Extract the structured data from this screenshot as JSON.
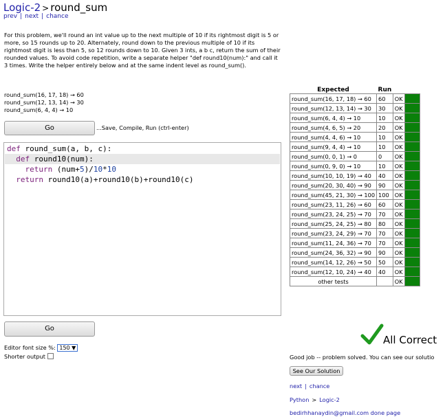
{
  "header": {
    "crumb": "Logic-2",
    "separator": ">",
    "title": "round_sum"
  },
  "nav": {
    "prev": "prev",
    "next": "next",
    "chance": "chance",
    "bar": "|"
  },
  "description": "For this problem, we'll round an int value up to the next multiple of 10 if its rightmost digit is 5 or more, so 15 rounds up to 20. Alternately, round down to the previous multiple of 10 if its rightmost digit is less than 5, so 12 rounds down to 10. Given 3 ints, a b c, return the sum of their rounded values. To avoid code repetition, write a separate helper \"def round10(num):\" and call it 3 times. Write the helper entirely below and at the same indent level as round_sum().",
  "examples": [
    "round_sum(16, 17, 18) → 60",
    "round_sum(12, 13, 14) → 30",
    "round_sum(6, 4, 4) → 10"
  ],
  "go_label": "Go",
  "save_hint": "...Save, Compile, Run (ctrl-enter)",
  "code": {
    "l1_kw": "def",
    "l1": " round_sum(a, b, c):",
    "l2_kw": "def",
    "l2": " round10(num):",
    "l3_kw": "return",
    "l3a": " (num+",
    "l3n1": "5",
    "l3b": ")/",
    "l3n2": "10",
    "l3c": "*",
    "l3n3": "10",
    "l4_kw": "return",
    "l4": " round10(a)+round10(b)+round10(c)"
  },
  "editor_font_label": "Editor font size %:",
  "editor_font_value": "150 ▼",
  "shorter_output_label": "Shorter output",
  "results": {
    "header_expected": "Expected",
    "header_run": "Run",
    "rows": [
      {
        "call": "round_sum(16, 17, 18) → 60",
        "run": "60",
        "status": "OK"
      },
      {
        "call": "round_sum(12, 13, 14) → 30",
        "run": "30",
        "status": "OK"
      },
      {
        "call": "round_sum(6, 4, 4) → 10",
        "run": "10",
        "status": "OK"
      },
      {
        "call": "round_sum(4, 6, 5) → 20",
        "run": "20",
        "status": "OK"
      },
      {
        "call": "round_sum(4, 4, 6) → 10",
        "run": "10",
        "status": "OK"
      },
      {
        "call": "round_sum(9, 4, 4) → 10",
        "run": "10",
        "status": "OK"
      },
      {
        "call": "round_sum(0, 0, 1) → 0",
        "run": "0",
        "status": "OK"
      },
      {
        "call": "round_sum(0, 9, 0) → 10",
        "run": "10",
        "status": "OK"
      },
      {
        "call": "round_sum(10, 10, 19) → 40",
        "run": "40",
        "status": "OK"
      },
      {
        "call": "round_sum(20, 30, 40) → 90",
        "run": "90",
        "status": "OK"
      },
      {
        "call": "round_sum(45, 21, 30) → 100",
        "run": "100",
        "status": "OK"
      },
      {
        "call": "round_sum(23, 11, 26) → 60",
        "run": "60",
        "status": "OK"
      },
      {
        "call": "round_sum(23, 24, 25) → 70",
        "run": "70",
        "status": "OK"
      },
      {
        "call": "round_sum(25, 24, 25) → 80",
        "run": "80",
        "status": "OK"
      },
      {
        "call": "round_sum(23, 24, 29) → 70",
        "run": "70",
        "status": "OK"
      },
      {
        "call": "round_sum(11, 24, 36) → 70",
        "run": "70",
        "status": "OK"
      },
      {
        "call": "round_sum(24, 36, 32) → 90",
        "run": "90",
        "status": "OK"
      },
      {
        "call": "round_sum(14, 12, 26) → 50",
        "run": "50",
        "status": "OK"
      },
      {
        "call": "round_sum(12, 10, 24) → 40",
        "run": "40",
        "status": "OK"
      }
    ],
    "other_tests": "other tests",
    "other_status": "OK",
    "ok_color": "#0a800a"
  },
  "all_correct": "All Correct",
  "checkmark_color": "#1f9a1f",
  "good_job": "Good job -- problem solved. You can see our solutio",
  "see_solution": "See Our Solution",
  "bottom_nav": {
    "next": "next",
    "chance": "chance",
    "bar": "|"
  },
  "breadcrumb": {
    "python": "Python",
    "gt": ">",
    "logic2": "Logic-2"
  },
  "footer": {
    "email": "bedirhhanaydin@gmail.com",
    "done_page": "done page"
  }
}
